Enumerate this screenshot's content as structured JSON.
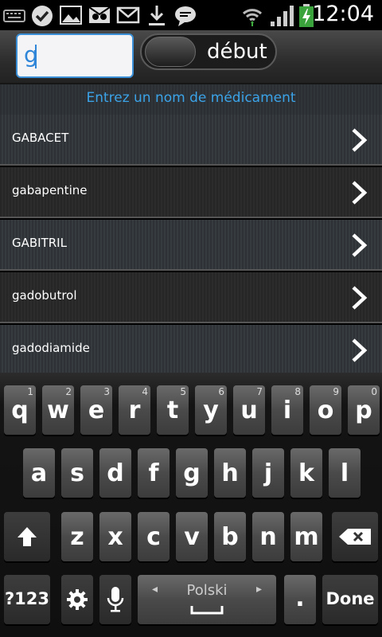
{
  "status": {
    "time": "12:04",
    "icons": [
      "keyboard-icon",
      "check-icon",
      "gallery-icon",
      "voicemail-icon",
      "mail-icon",
      "download-icon",
      "chat-icon",
      "wifi-icon",
      "signal-icon",
      "battery-icon"
    ]
  },
  "search": {
    "value": "g"
  },
  "toggle": {
    "label": "début"
  },
  "hint": "Entrez un nom de médicament",
  "list": [
    {
      "label": "GABACET"
    },
    {
      "label": "gabapentine"
    },
    {
      "label": "GABITRIL"
    },
    {
      "label": "gadobutrol"
    },
    {
      "label": "gadodiamide"
    }
  ],
  "keyboard": {
    "row1": [
      {
        "ch": "q",
        "num": "1"
      },
      {
        "ch": "w",
        "num": "2"
      },
      {
        "ch": "e",
        "num": "3"
      },
      {
        "ch": "r",
        "num": "4"
      },
      {
        "ch": "t",
        "num": "5"
      },
      {
        "ch": "y",
        "num": "6"
      },
      {
        "ch": "u",
        "num": "7"
      },
      {
        "ch": "i",
        "num": "8"
      },
      {
        "ch": "o",
        "num": "9"
      },
      {
        "ch": "p",
        "num": "0"
      }
    ],
    "row2": [
      "a",
      "s",
      "d",
      "f",
      "g",
      "h",
      "j",
      "k",
      "l"
    ],
    "row3": [
      "z",
      "x",
      "c",
      "v",
      "b",
      "n",
      "m"
    ],
    "sym": "?123",
    "space_lang": "Polski",
    "period": ".",
    "done": "Done"
  }
}
